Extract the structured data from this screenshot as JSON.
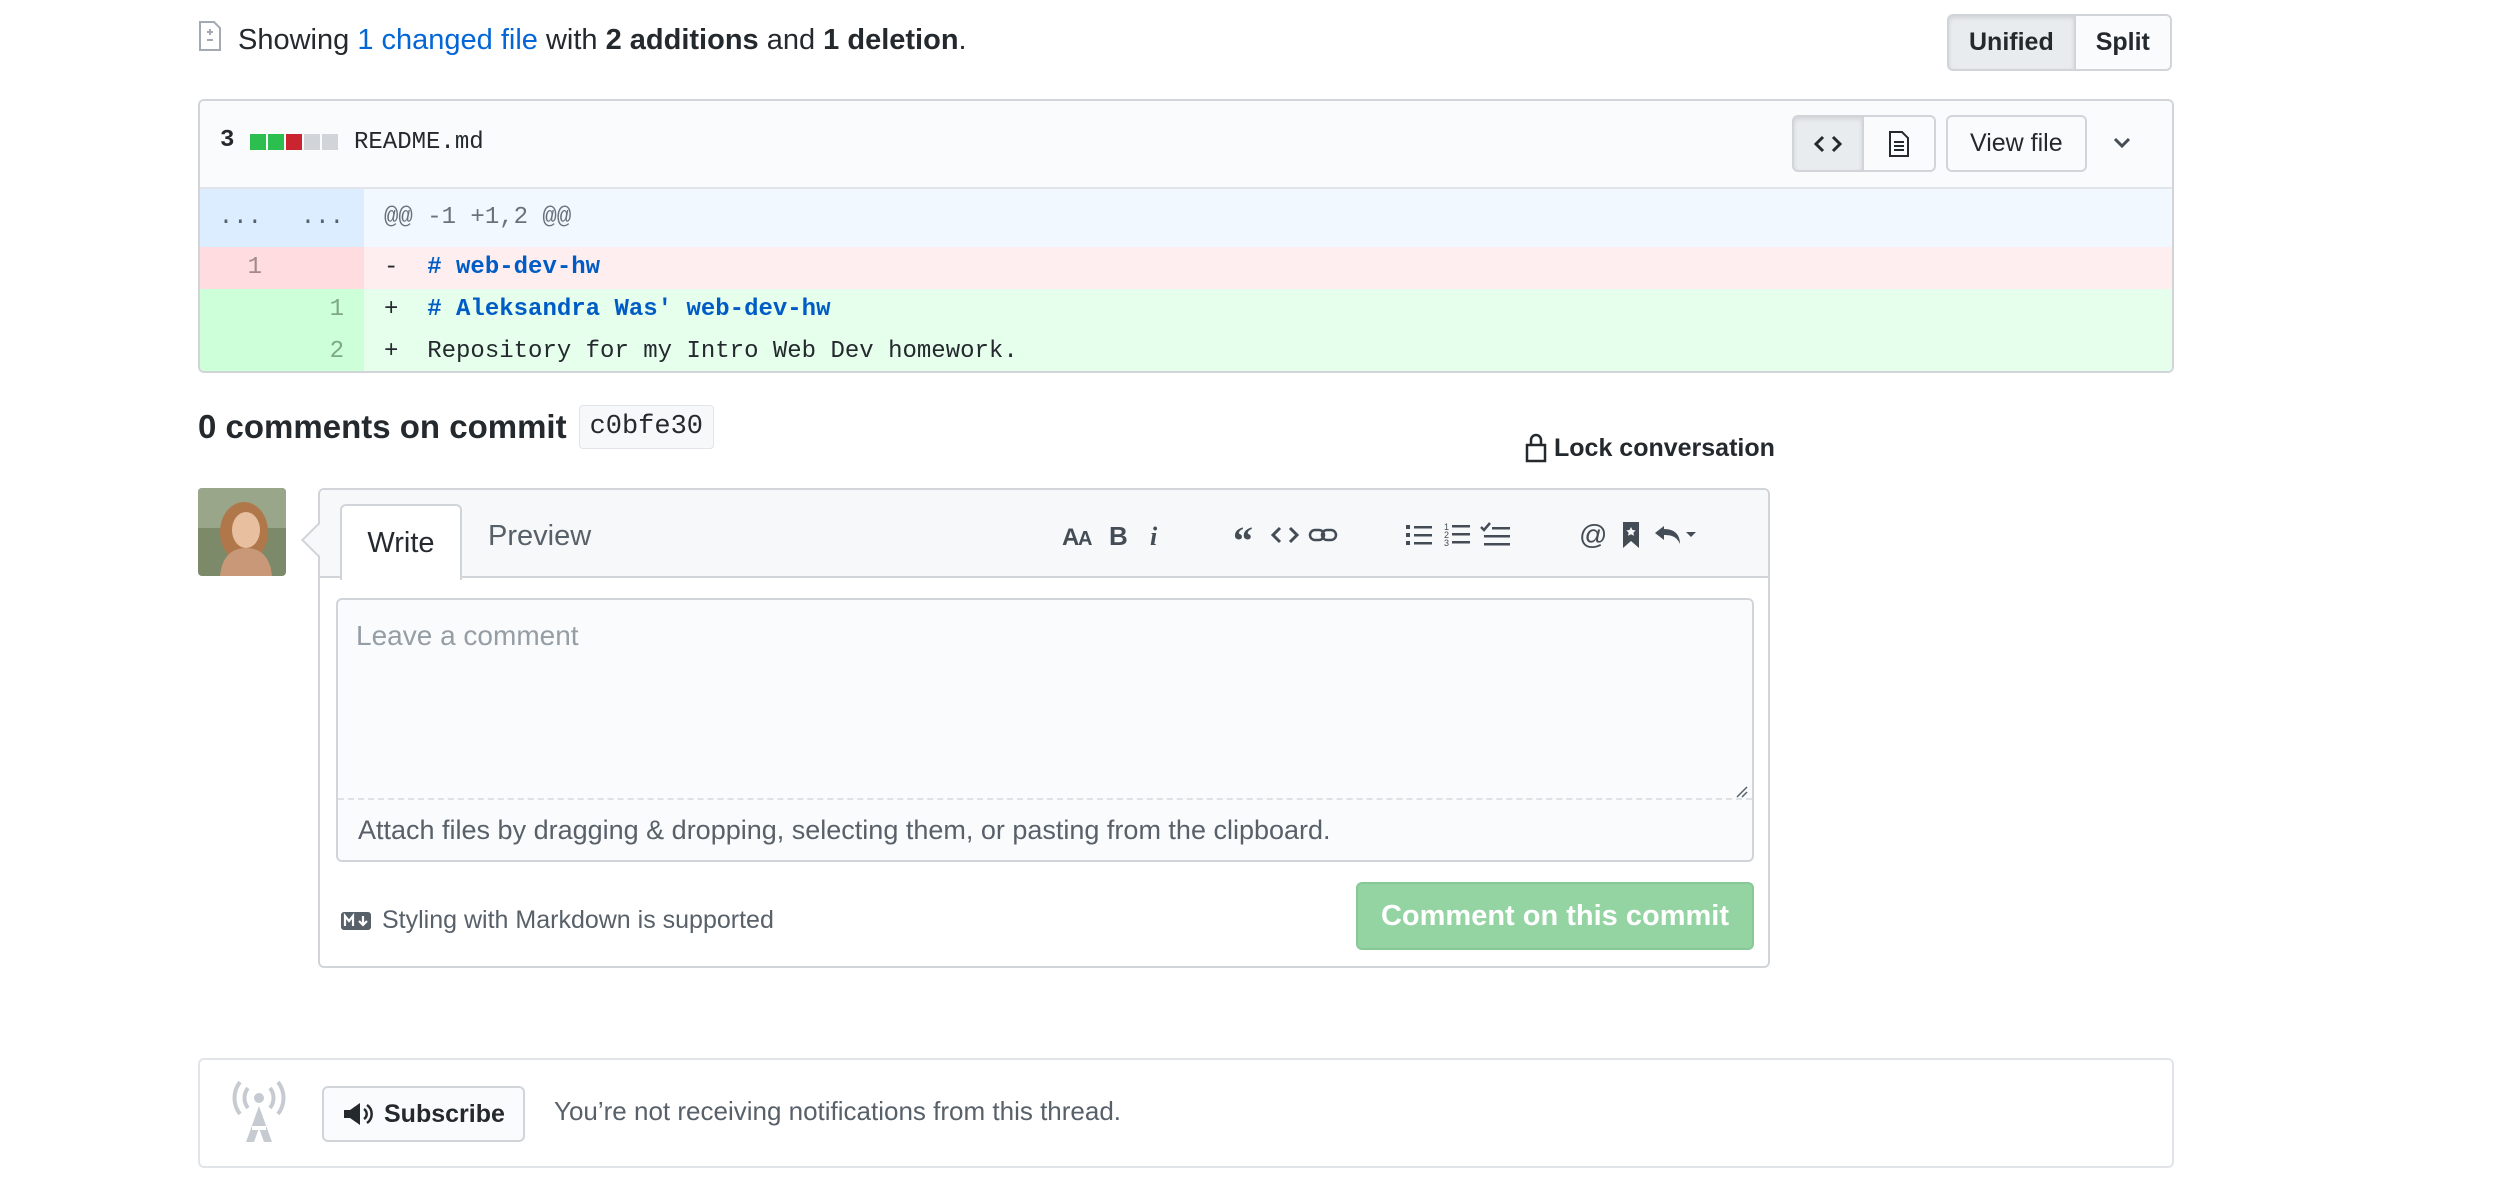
{
  "summary": {
    "prefix": "Showing ",
    "changed_link": "1 changed file",
    "with": " with ",
    "additions": "2 additions",
    "and": " and ",
    "deletions": "1 deletion",
    "suffix": "."
  },
  "diff_view": {
    "unified": "Unified",
    "split": "Split"
  },
  "file": {
    "changes": "3",
    "name": "README.md",
    "view_file": "View file",
    "diffstat_colors": [
      "#2cbe4e",
      "#2cbe4e",
      "#cb2431",
      "#d1d5da",
      "#d1d5da"
    ],
    "hunk": {
      "left": "...",
      "right": "...",
      "header": "@@ -1 +1,2 @@"
    },
    "lines": [
      {
        "type": "del",
        "old": "1",
        "new": "",
        "marker": "-",
        "text": "# web-dev-hw"
      },
      {
        "type": "add",
        "old": "",
        "new": "1",
        "marker": "+",
        "text": "# Aleksandra Was' web-dev-hw"
      },
      {
        "type": "add",
        "old": "",
        "new": "2",
        "marker": "+",
        "text": "Repository for my Intro Web Dev homework."
      }
    ]
  },
  "comments": {
    "title": "0 comments on commit",
    "sha": "c0bfe30",
    "lock": "Lock conversation"
  },
  "editor": {
    "tab_write": "Write",
    "tab_preview": "Preview",
    "placeholder": "Leave a comment",
    "drop_hint": "Attach files by dragging & dropping, selecting them, or pasting from the clipboard.",
    "markdown_note": "Styling with Markdown is supported",
    "submit": "Comment on this commit",
    "toolbar_icons": [
      "text-size-icon",
      "bold-icon",
      "italic-icon",
      "quote-icon",
      "code-icon",
      "link-icon",
      "bullet-list-icon",
      "numbered-list-icon",
      "task-list-icon",
      "mention-icon",
      "bookmark-icon",
      "reply-icon"
    ]
  },
  "subscribe": {
    "button": "Subscribe",
    "text": "You’re not receiving notifications from this thread."
  },
  "colors": {
    "link": "#0366d6",
    "addition_bg": "#e6ffed",
    "deletion_bg": "#ffeef0",
    "submit_disabled": "#94d3a2"
  }
}
